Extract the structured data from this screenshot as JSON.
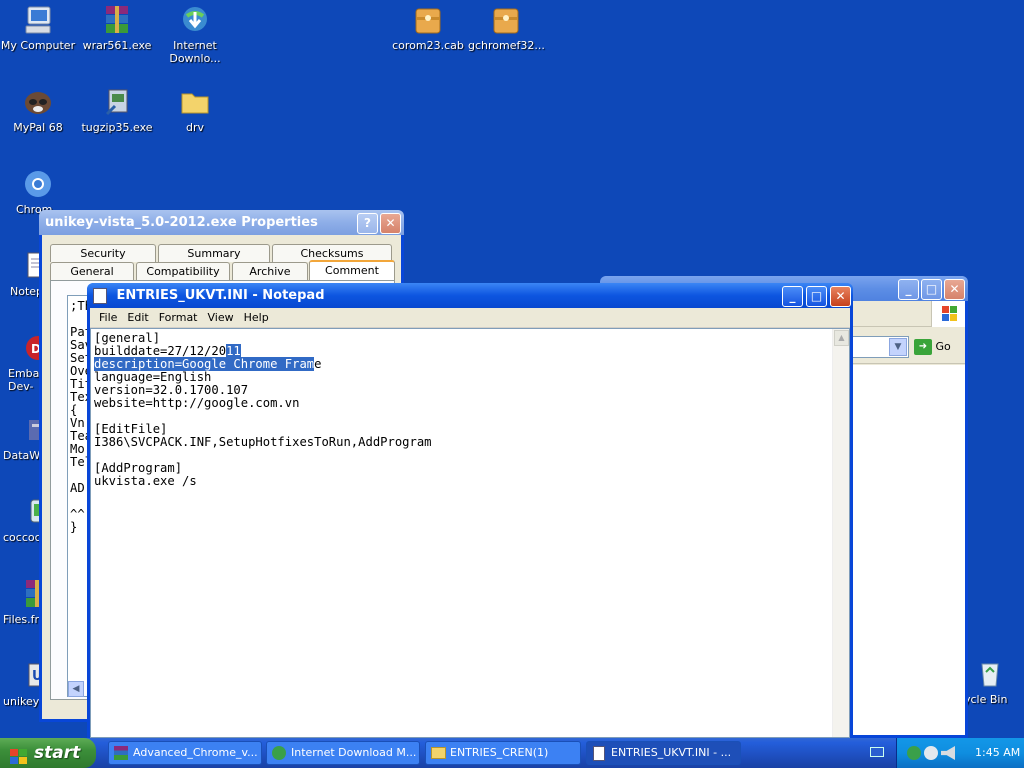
{
  "desktop_icons": [
    {
      "label": "My Computer",
      "icon": "my-computer-icon"
    },
    {
      "label": "wrar561.exe",
      "icon": "winrar-icon"
    },
    {
      "label": "Internet Downlo...",
      "icon": "idm-icon"
    },
    {
      "label": "corom23.cab",
      "icon": "cab-archive-icon"
    },
    {
      "label": "gchromef32...",
      "icon": "cab-archive-icon"
    },
    {
      "label": "MyPal 68",
      "icon": "mypal-icon"
    },
    {
      "label": "tugzip35.exe",
      "icon": "tugzip-icon"
    },
    {
      "label": "drv",
      "icon": "folder-icon"
    },
    {
      "label": "Chrom",
      "icon": "chromium-icon"
    },
    {
      "label": "Notep",
      "icon": "notepad-icon"
    },
    {
      "label": "Embar Dev-",
      "icon": "embarcadero-icon"
    },
    {
      "label": "DataWa",
      "icon": "datawatch-icon"
    },
    {
      "label": "coccoc_",
      "icon": "coccoc-icon"
    },
    {
      "label": "Files.fr",
      "icon": "winrar-icon"
    },
    {
      "label": "unikey-",
      "icon": "unikey-icon"
    },
    {
      "label": "ycle Bin",
      "icon": "recycle-bin-icon"
    }
  ],
  "properties_dialog": {
    "title": "unikey-vista_5.0-2012.exe Properties",
    "tabs_row1": [
      "Security",
      "Summary",
      "Checksums"
    ],
    "tabs_row2": [
      "General",
      "Compatibility",
      "Archive",
      "Comment"
    ],
    "comment_lines": [
      ";Th",
      "",
      "Pat",
      "Sav",
      "Set",
      "Ove",
      "Tit",
      "Tex",
      "{",
      "Vn",
      "Tea",
      "Mo",
      "Tel",
      "",
      "AD:",
      "",
      "^^",
      "}"
    ]
  },
  "explorer_window": {
    "go_label": "Go"
  },
  "notepad": {
    "title": "ENTRIES_UKVT.INI - Notepad",
    "menu": [
      "File",
      "Edit",
      "Format",
      "View",
      "Help"
    ],
    "text_before_sel": "[general]\nbuilddate=27/12/20",
    "selected_text": "11\ndescription=Google Chrome Fram",
    "text_after_sel": "e\nlanguage=English\nversion=32.0.1700.107\nwebsite=http://google.com.vn\n\n[EditFile]\nI386\\SVCPACK.INF,SetupHotfixesToRun,AddProgram\n\n[AddProgram]\nukvista.exe /s"
  },
  "taskbar": {
    "start_label": "start",
    "items": [
      {
        "label": "Advanced_Chrome_v...",
        "icon": "winrar-icon"
      },
      {
        "label": "Internet Download M...",
        "icon": "idm-icon"
      },
      {
        "label": "ENTRIES_CREN(1)",
        "icon": "folder-icon"
      },
      {
        "label": "ENTRIES_UKVT.INI - ...",
        "icon": "notepad-icon"
      }
    ],
    "clock": "1:45 AM"
  }
}
